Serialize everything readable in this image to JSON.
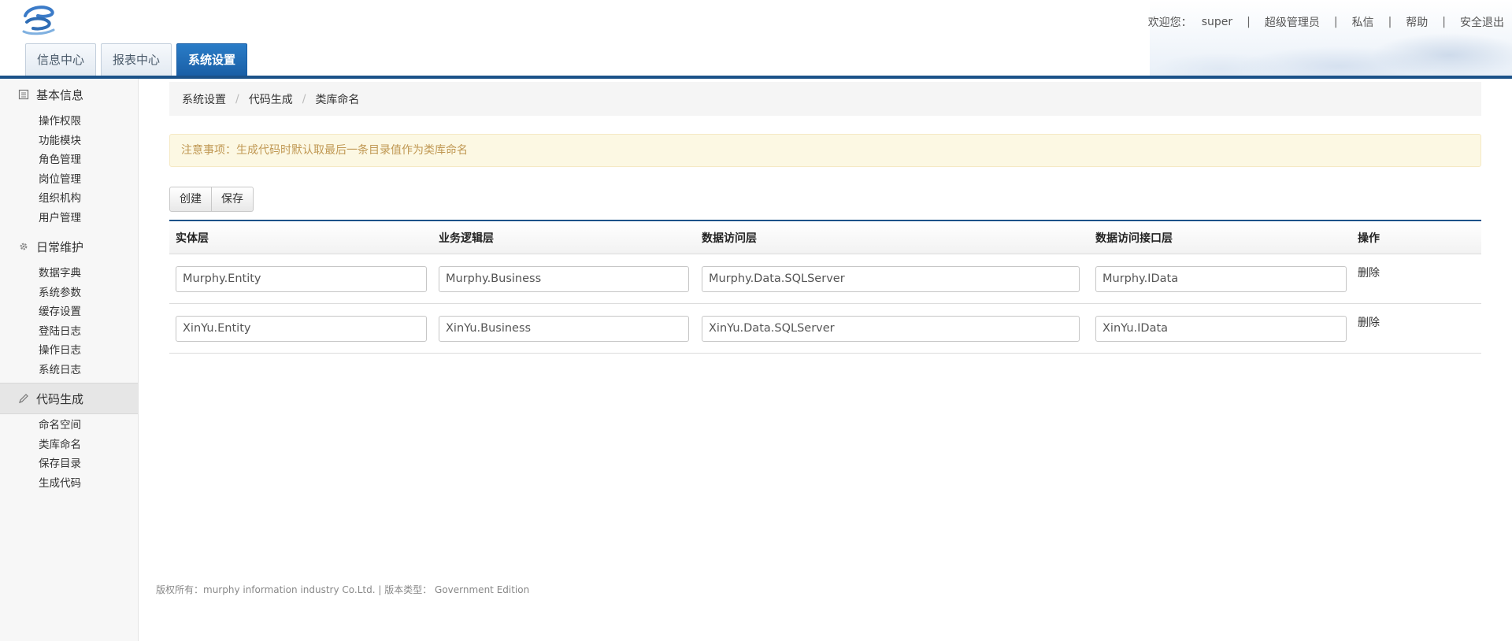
{
  "header": {
    "welcome_label": "欢迎您：",
    "username": "super",
    "links": [
      "超级管理员",
      "私信",
      "帮助",
      "安全退出"
    ],
    "tabs": [
      {
        "label": "信息中心",
        "active": false
      },
      {
        "label": "报表中心",
        "active": false
      },
      {
        "label": "系统设置",
        "active": true
      }
    ]
  },
  "sidebar": {
    "groups": [
      {
        "title": "基本信息",
        "icon": "list-icon",
        "items": [
          "操作权限",
          "功能模块",
          "角色管理",
          "岗位管理",
          "组织机构",
          "用户管理"
        ]
      },
      {
        "title": "日常维护",
        "icon": "gear-icon",
        "items": [
          "数据字典",
          "系统参数",
          "缓存设置",
          "登陆日志",
          "操作日志",
          "系统日志"
        ]
      },
      {
        "title": "代码生成",
        "icon": "pencil-icon",
        "active": true,
        "items": [
          "命名空间",
          "类库命名",
          "保存目录",
          "生成代码"
        ]
      }
    ]
  },
  "breadcrumb": [
    "系统设置",
    "代码生成",
    "类库命名"
  ],
  "alert": "注意事项：生成代码时默认取最后一条目录值作为类库命名",
  "toolbar": {
    "create_label": "创建",
    "save_label": "保存"
  },
  "table": {
    "columns": [
      "实体层",
      "业务逻辑层",
      "数据访问层",
      "数据访问接口层",
      "操作"
    ],
    "rows": [
      {
        "entity": "Murphy.Entity",
        "business": "Murphy.Business",
        "data": "Murphy.Data.SQLServer",
        "idata": "Murphy.IData",
        "action": "删除"
      },
      {
        "entity": "XinYu.Entity",
        "business": "XinYu.Business",
        "data": "XinYu.Data.SQLServer",
        "idata": "XinYu.IData",
        "action": "删除"
      }
    ]
  },
  "footer": "版权所有：murphy information industry Co.Ltd. | 版本类型： Government Edition",
  "colors": {
    "primary": "#1b5289",
    "active_tab": "#1f6bb5",
    "alert_bg": "#fcf8e3",
    "alert_text": "#c09853"
  }
}
